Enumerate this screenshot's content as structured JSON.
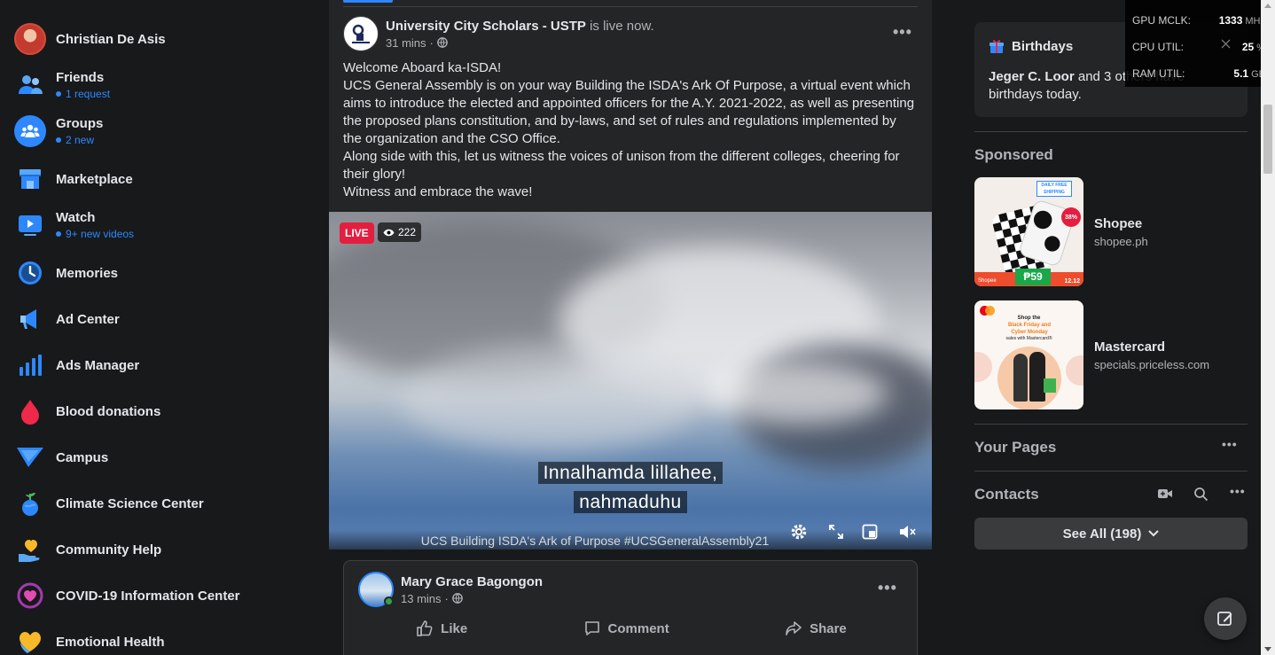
{
  "sidebar": {
    "user_name": "Christian De Asis",
    "items": [
      {
        "label": "Friends",
        "sub": "1 request"
      },
      {
        "label": "Groups",
        "sub": "2 new"
      },
      {
        "label": "Marketplace"
      },
      {
        "label": "Watch",
        "sub": "9+ new videos"
      },
      {
        "label": "Memories"
      },
      {
        "label": "Ad Center"
      },
      {
        "label": "Ads Manager"
      },
      {
        "label": "Blood donations"
      },
      {
        "label": "Campus"
      },
      {
        "label": "Climate Science Center"
      },
      {
        "label": "Community Help"
      },
      {
        "label": "COVID-19 Information Center"
      },
      {
        "label": "Emotional Health"
      }
    ]
  },
  "post": {
    "page_name": "University City Scholars - USTP",
    "status": "is live now.",
    "time": "31 mins",
    "body": [
      "Welcome Aboard ka-ISDA!",
      "UCS General Assembly is on your way Building the ISDA's Ark Of Purpose, a virtual event which aims to introduce the elected and appointed officers for the A.Y. 2021-2022, as well as presenting the proposed plans constitution, and by-laws, and set of rules and regulations implemented by the organization and the CSO Office.",
      "Along side with this, let us witness the voices of unison from the different colleges, cheering for their glory!",
      "Witness and embrace the wave!"
    ],
    "video": {
      "live_label": "LIVE",
      "viewers": "222",
      "subtitle_line1": "Innalhamda lillahee,",
      "subtitle_line2": "nahmaduhu",
      "caption": "UCS Building ISDA's Ark of Purpose #UCSGeneralAssembly21"
    }
  },
  "post2": {
    "author": "Mary Grace Bagongon",
    "time": "13 mins",
    "actions": {
      "like": "Like",
      "comment": "Comment",
      "share": "Share"
    }
  },
  "right": {
    "birthdays": {
      "title": "Birthdays",
      "name": "Jeger C. Loor",
      "text_after": " and 3 others have birthdays today."
    },
    "sponsored_title": "Sponsored",
    "ads": [
      {
        "name": "Shopee",
        "url": "shopee.ph",
        "price": "₱59",
        "discount": "38%",
        "date": "12.12",
        "tag": "DAILY FREE SHIPPING"
      },
      {
        "name": "Mastercard",
        "url": "specials.priceless.com",
        "headline1": "Shop the",
        "headline2": "Black Friday and Cyber Monday",
        "headline3": "sales with Mastercard®"
      }
    ],
    "your_pages_title": "Your Pages",
    "contacts_title": "Contacts",
    "see_all": "See All (198)"
  },
  "perf": {
    "gpu_label": "GPU MCLK:",
    "gpu_value": "1333",
    "gpu_unit": "MHz",
    "cpu_label": "CPU UTIL:",
    "cpu_value": "25",
    "cpu_unit": "%",
    "ram_label": "RAM UTIL:",
    "ram_value": "5.1",
    "ram_unit": "GB"
  },
  "colors": {
    "accent": "#2d88ff",
    "live": "#e41e3f",
    "background": "#18191a",
    "card": "#242526"
  }
}
